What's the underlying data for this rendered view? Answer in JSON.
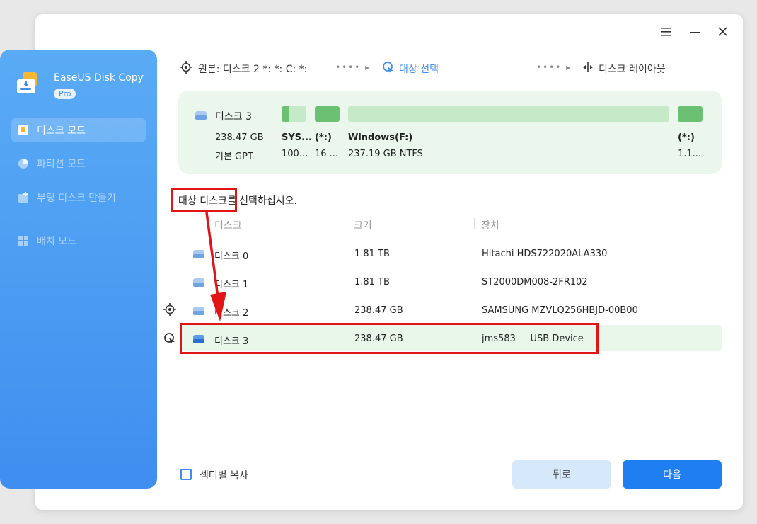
{
  "window": {
    "menu_icon": "menu-icon",
    "minimize_icon": "minimize-icon",
    "close_icon": "close-icon"
  },
  "sidebar": {
    "app_name": "EaseUS Disk Copy",
    "badge": "Pro",
    "items": [
      {
        "label": "디스크 모드",
        "icon": "disk-mode-icon",
        "active": true
      },
      {
        "label": "파티션 모드",
        "icon": "partition-mode-icon",
        "active": false
      },
      {
        "label": "부팅 디스크 만들기",
        "icon": "boot-disk-icon",
        "active": false
      },
      {
        "label": "배치 모드",
        "icon": "batch-mode-icon",
        "active": false
      }
    ]
  },
  "steps": {
    "source": "원본: 디스크 2 *: *: C: *:",
    "target": "대상 선택",
    "layout": "디스크 레이아웃"
  },
  "disk_panel": {
    "name": "디스크 3",
    "size": "238.47 GB",
    "type": "기본 GPT",
    "partitions": [
      {
        "label": "SYS...",
        "detail": "100..."
      },
      {
        "label": "(*:)",
        "detail": "16 ..."
      },
      {
        "label": "Windows(F:)",
        "detail": "237.19 GB NTFS"
      },
      {
        "label": "(*:)",
        "detail": "1.1..."
      }
    ],
    "colors": {
      "light": "#c6e9c8",
      "dark": "#6cc073"
    }
  },
  "instruction": "대상 디스크를 선택하십시오.",
  "table": {
    "headers": [
      "디스크",
      "크기",
      "장치"
    ],
    "rows": [
      {
        "disk": "디스크 0",
        "size": "1.81 TB",
        "device": "Hitachi HDS722020ALA330"
      },
      {
        "disk": "디스크 1",
        "size": "1.81 TB",
        "device": "ST2000DM008-2FR102"
      },
      {
        "disk": "디스크 2",
        "size": "238.47 GB",
        "device": "SAMSUNG MZVLQ256HBJD-00B00"
      },
      {
        "disk": "디스크 3",
        "size": "238.47 GB",
        "device": "jms583     USB Device"
      }
    ]
  },
  "footer": {
    "sector_copy": "섹터별 복사",
    "back": "뒤로",
    "next": "다음"
  },
  "colors": {
    "accent": "#1f7ef2",
    "sidebar": "#4a9cf3",
    "highlight": "#e01515"
  }
}
